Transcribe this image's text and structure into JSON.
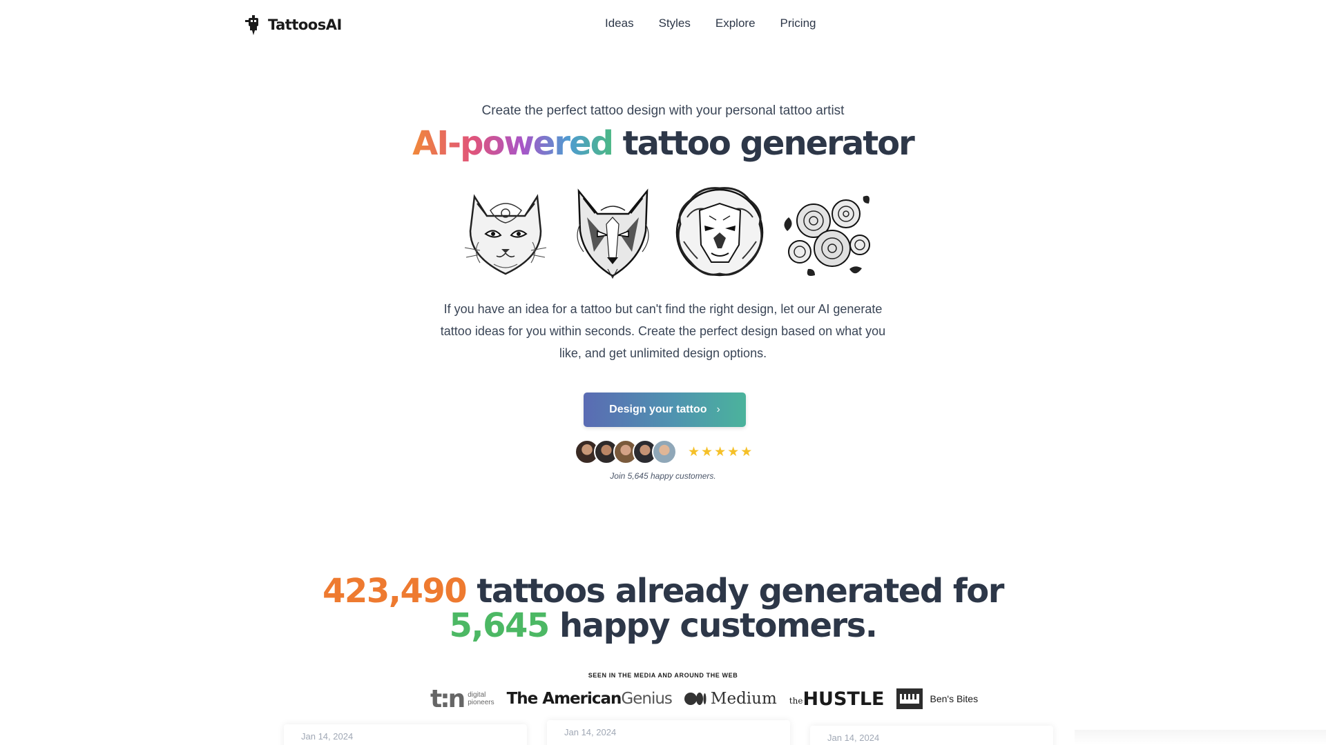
{
  "brand": {
    "name": "TattoosAI",
    "icon": "robot-tattoo-machine-icon"
  },
  "nav": {
    "items": [
      {
        "label": "Ideas"
      },
      {
        "label": "Styles"
      },
      {
        "label": "Explore"
      },
      {
        "label": "Pricing"
      }
    ]
  },
  "hero": {
    "subtitle": "Create the perfect tattoo design with your personal tattoo artist",
    "title_gradient": "AI-powered",
    "title_rest": " tattoo generator",
    "images": [
      {
        "subject": "cat"
      },
      {
        "subject": "wolf"
      },
      {
        "subject": "lion"
      },
      {
        "subject": "roses"
      }
    ],
    "description": "If you have an idea for a tattoo but can't find the right design, let our AI generate tattoo ideas for you within seconds. Create the perfect design based on what you like, and get unlimited design options.",
    "cta_label": "Design your tattoo",
    "rating_stars": 5,
    "avatar_count": 5,
    "social_caption": "Join 5,645 happy customers."
  },
  "stats": {
    "tattoos_count": "423,490",
    "line1_rest": " tattoos already generated for",
    "customers_count": "5,645",
    "line2_rest": " happy customers."
  },
  "media": {
    "heading": "SEEN IN THE MEDIA AND AROUND THE WEB",
    "tn_mark": "t:n",
    "tn_line1": "digital",
    "tn_line2": "pioneers",
    "amgen_bold": "The American",
    "amgen_light": " Genius",
    "medium": "Medium",
    "hustle_small": "the",
    "hustle": "HUSTLE",
    "bens": "Ben's Bites"
  },
  "cards": [
    {
      "date": "Jan 14, 2024"
    },
    {
      "date": "Jan 14, 2024"
    },
    {
      "date": "Jan 14, 2024"
    }
  ],
  "colors": {
    "accent_orange": "#ee7a30",
    "accent_green": "#4cb864",
    "text_dark": "#2d3748",
    "star": "#f5c028"
  }
}
